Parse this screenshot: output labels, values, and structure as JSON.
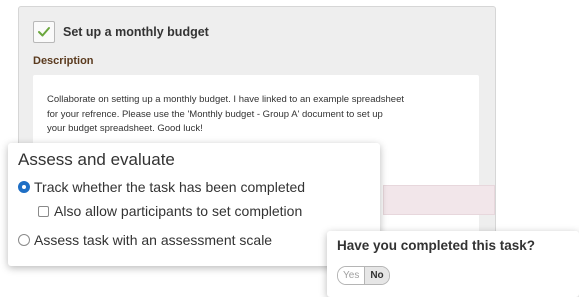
{
  "task": {
    "title": "Set up a monthly budget",
    "description_label": "Description",
    "description_lines": [
      "Collaborate on setting up a monthly budget. I have linked to an example spreadsheet",
      "for your refrence. Please use the 'Monthly budget - Group A' document  to set up",
      "your budget spreadsheet. Good luck!"
    ],
    "icon": "check-document-icon"
  },
  "assess": {
    "title": "Assess and evaluate",
    "options": [
      {
        "label": "Track whether the task has been completed",
        "selected": true
      },
      {
        "label": "Also allow participants to set completion",
        "checked": false
      },
      {
        "label": "Assess task with an assessment scale",
        "selected": false
      }
    ]
  },
  "completion": {
    "question": "Have you completed this task?",
    "yes_label": "Yes",
    "no_label": "No",
    "selected": "No"
  }
}
